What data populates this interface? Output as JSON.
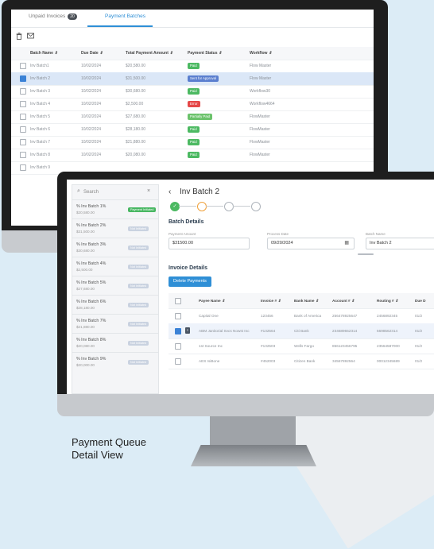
{
  "caption": {
    "line1": "Payment Queue",
    "line2": "Detail View"
  },
  "back_screen": {
    "tabs": [
      {
        "label": "Unpaid Invoices",
        "count": "20"
      },
      {
        "label": "Payment Batches"
      }
    ],
    "toolbar": {
      "delete_icon": "trash-icon",
      "mail_icon": "mail-icon"
    },
    "columns": [
      "Batch Name",
      "Due Date",
      "Total Payment Amount",
      "Payment Status",
      "Workflow"
    ],
    "sort_glyph": "⇕",
    "rows": [
      {
        "name": "Inv Batch1",
        "due": "10/02/2024",
        "amount": "$20,580.00",
        "status": "Paid",
        "status_kind": "paid",
        "workflow": "Flow Master",
        "checked": false
      },
      {
        "name": "Inv Batch 2",
        "due": "10/02/2024",
        "amount": "$31,500.00",
        "status": "Sent for Approval",
        "status_kind": "sent",
        "workflow": "Flow Master",
        "checked": true
      },
      {
        "name": "Inv Batch 3",
        "due": "10/02/2024",
        "amount": "$30,680.00",
        "status": "Paid",
        "status_kind": "paid",
        "workflow": "Workflow30",
        "checked": false
      },
      {
        "name": "Inv Batch 4",
        "due": "10/02/2024",
        "amount": "$2,500.00",
        "status": "Error",
        "status_kind": "error",
        "workflow": "Workflow4664",
        "checked": false
      },
      {
        "name": "Inv Batch 5",
        "due": "10/02/2024",
        "amount": "$27,680.00",
        "status": "Partially Paid",
        "status_kind": "partial",
        "workflow": "FlowMaster",
        "checked": false
      },
      {
        "name": "Inv Batch 6",
        "due": "10/02/2024",
        "amount": "$28,180.00",
        "status": "Paid",
        "status_kind": "paid",
        "workflow": "FlowMaster",
        "checked": false
      },
      {
        "name": "Inv Batch 7",
        "due": "10/02/2024",
        "amount": "$21,880.00",
        "status": "Paid",
        "status_kind": "paid",
        "workflow": "FlowMaster",
        "checked": false
      },
      {
        "name": "Inv Batch 8",
        "due": "10/02/2024",
        "amount": "$20,080.00",
        "status": "Paid",
        "status_kind": "paid",
        "workflow": "FlowMaster",
        "checked": false
      },
      {
        "name": "Inv Batch 9",
        "due": "",
        "amount": "",
        "status": "",
        "status_kind": "",
        "workflow": "",
        "checked": false
      }
    ]
  },
  "front_screen": {
    "search": {
      "placeholder": "Search"
    },
    "batches": [
      {
        "name": "% Inv Batch 1%",
        "amount": "$20,580.00",
        "tag": "Payment Initiated",
        "tag_kind": "paid"
      },
      {
        "name": "% Inv Batch 2%",
        "amount": "$31,500.00",
        "tag": "Not Initiated",
        "tag_kind": "muted"
      },
      {
        "name": "% Inv Batch 3%",
        "amount": "$30,680.00",
        "tag": "Not Initiated",
        "tag_kind": "muted"
      },
      {
        "name": "% Inv Batch 4%",
        "amount": "$2,500.00",
        "tag": "Not Initiated",
        "tag_kind": "muted"
      },
      {
        "name": "% Inv Batch 5%",
        "amount": "$27,680.00",
        "tag": "Not Initiated",
        "tag_kind": "muted"
      },
      {
        "name": "% Inv Batch 6%",
        "amount": "$28,180.00",
        "tag": "Not Initiated",
        "tag_kind": "muted"
      },
      {
        "name": "% Inv Batch 7%",
        "amount": "$21,880.00",
        "tag": "Not Initiated",
        "tag_kind": "muted"
      },
      {
        "name": "% Inv Batch 8%",
        "amount": "$20,080.00",
        "tag": "Not Initiated",
        "tag_kind": "muted"
      },
      {
        "name": "% Inv Batch 9%",
        "amount": "$20,000.00",
        "tag": "Not Initiated",
        "tag_kind": "muted"
      }
    ],
    "title": "Inv Batch 2",
    "batch_details": {
      "heading": "Batch Details",
      "payment_amount_label": "Payment Amount",
      "payment_amount": "$31500.00",
      "process_date_label": "Process Date",
      "process_date": "09/20/2024",
      "batch_name_label": "Batch Name",
      "batch_name": "Inv Batch 2"
    },
    "invoice_details": {
      "heading": "Invoice Details",
      "delete_label": "Delete Payments",
      "columns": [
        "Payee Name",
        "Invoice #",
        "Bank Name",
        "Account #",
        "Routing #",
        "Due D"
      ],
      "rows": [
        {
          "payee": "Capital One",
          "invoice": "123456",
          "bank": "Bank of America",
          "account": "256478925647",
          "routing": "2456892345",
          "due": "01/2",
          "checked": false,
          "doc": false
        },
        {
          "payee": "ABM Janitorial Svcs Nowst Inc",
          "invoice": "#132564",
          "bank": "Citi Bank",
          "account": "234689652314",
          "routing": "5698562314",
          "due": "01/2",
          "checked": true,
          "doc": true
        },
        {
          "payee": "1st Source Inc",
          "invoice": "#132503",
          "bank": "Wells Fargo",
          "account": "856123456795",
          "routing": "23564587000",
          "due": "01/2",
          "checked": false,
          "doc": false
        },
        {
          "payee": "AES IsiBone",
          "invoice": "#452003",
          "bank": "Citizen Bank",
          "account": "34567892564",
          "routing": "00012345689",
          "due": "01/2",
          "checked": false,
          "doc": false
        }
      ]
    }
  },
  "colors": {
    "accent": "#2f8fd6",
    "paid": "#4cb962",
    "error": "#e54848",
    "sent": "#5b7fcf",
    "step_current": "#f0a13a"
  }
}
